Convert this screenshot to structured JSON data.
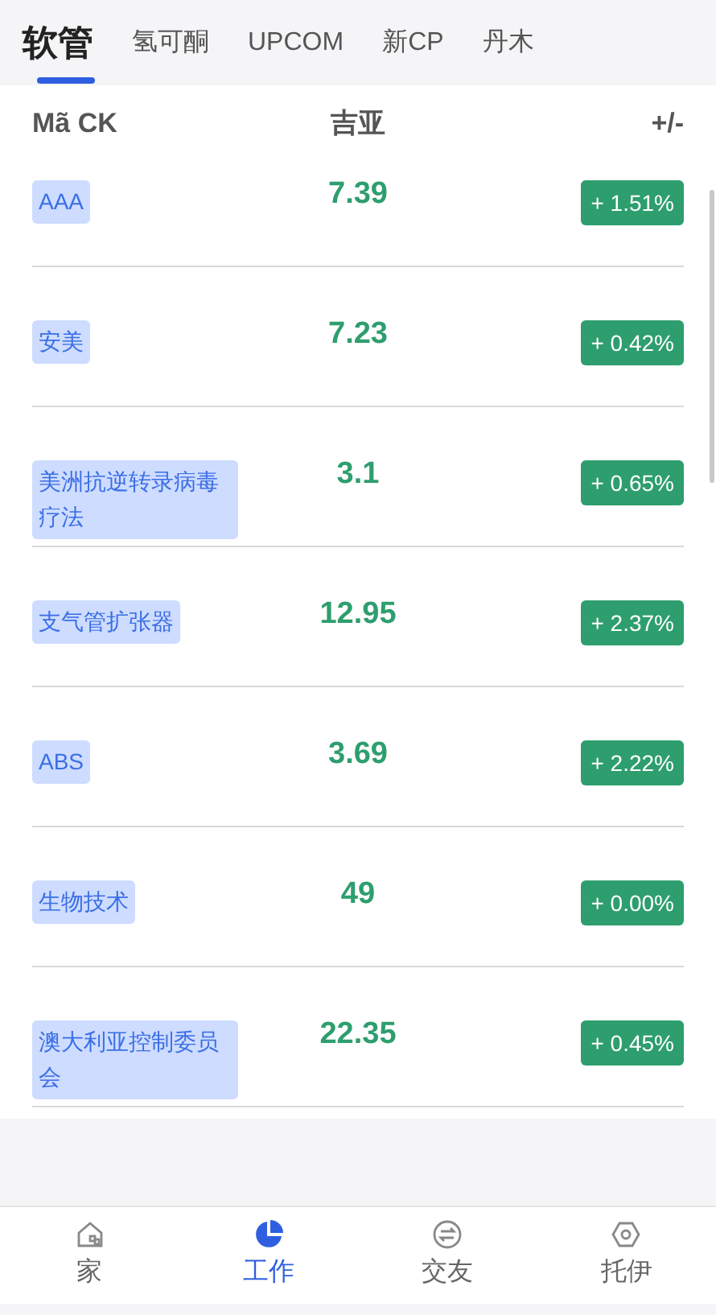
{
  "tabs": [
    {
      "label": "软管",
      "selected": true
    },
    {
      "label": "氢可酮",
      "selected": false
    },
    {
      "label": "UPCOM",
      "selected": false
    },
    {
      "label": "新CP",
      "selected": false
    },
    {
      "label": "丹木",
      "selected": false
    }
  ],
  "table": {
    "columns": [
      "Mã CK",
      "吉亚",
      "+/-"
    ],
    "rows": [
      {
        "code": "AAA",
        "price": "7.39",
        "change": "+ 1.51%"
      },
      {
        "code": "安美",
        "price": "7.23",
        "change": "+ 0.42%"
      },
      {
        "code": "美洲抗逆转录病毒疗法",
        "price": "3.1",
        "change": "+ 0.65%"
      },
      {
        "code": "支气管扩张器",
        "price": "12.95",
        "change": "+ 2.37%"
      },
      {
        "code": "ABS",
        "price": "3.69",
        "change": "+ 2.22%"
      },
      {
        "code": "生物技术",
        "price": "49",
        "change": "+ 0.00%"
      },
      {
        "code": "澳大利亚控制委员会",
        "price": "22.35",
        "change": "+ 0.45%"
      }
    ]
  },
  "bottom_nav": [
    {
      "label": "家",
      "kind": "home",
      "selected": false
    },
    {
      "label": "工作",
      "kind": "pie",
      "selected": true
    },
    {
      "label": "交友",
      "kind": "exchange",
      "selected": false
    },
    {
      "label": "托伊",
      "kind": "hexagon",
      "selected": false
    }
  ]
}
